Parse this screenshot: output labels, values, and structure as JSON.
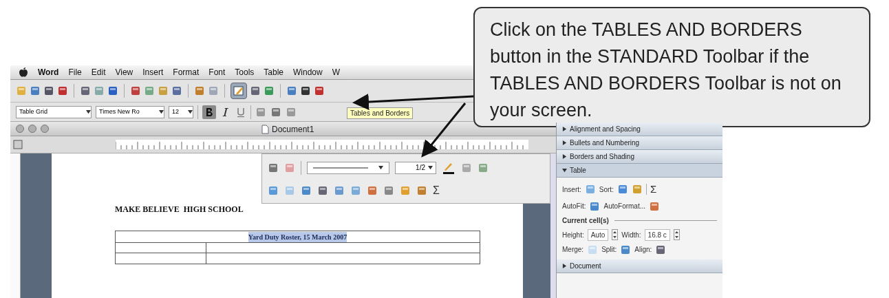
{
  "menu_bar": {
    "items": [
      "Word",
      "File",
      "Edit",
      "View",
      "Insert",
      "Format",
      "Font",
      "Tools",
      "Table",
      "Window",
      "W"
    ]
  },
  "standard_toolbar": {
    "tooltip": "Tables and Borders"
  },
  "formatting_toolbar": {
    "style": "Table Grid",
    "font": "Times New Ro",
    "size": "12",
    "bold": true
  },
  "window": {
    "title": "Document1"
  },
  "tables_toolbar": {
    "line_weight": "1/2",
    "sum": "Σ"
  },
  "document": {
    "heading": "MAKE BELIEVE  HIGH SCHOOL",
    "table_title": "Yard Duty Roster, 15 March 2007"
  },
  "panel": {
    "sections": [
      {
        "label": "Alignment and Spacing",
        "expanded": false
      },
      {
        "label": "Bullets and Numbering",
        "expanded": false
      },
      {
        "label": "Borders and Shading",
        "expanded": false
      },
      {
        "label": "Table",
        "expanded": true
      }
    ],
    "insert_label": "Insert:",
    "sort_label": "Sort:",
    "sum": "Σ",
    "autofit_label": "AutoFit:",
    "autoformat_label": "AutoFormat...",
    "current_cells": "Current cell(s)",
    "height_label": "Height:",
    "height_value": "Auto",
    "width_label": "Width:",
    "width_value": "16.8 c",
    "merge_label": "Merge:",
    "split_label": "Split:",
    "align_label": "Align:",
    "last_section": {
      "label": "Document",
      "expanded": false
    }
  },
  "callout": {
    "text": "Click on the TABLES AND BORDERS button in the STANDARD Toolbar if the TABLES AND BORDERS Toolbar is not on your screen."
  }
}
